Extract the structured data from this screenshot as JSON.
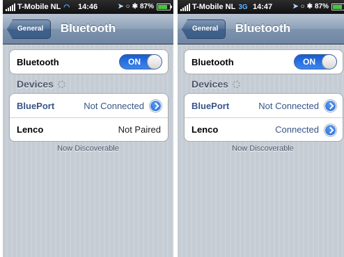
{
  "screens": [
    {
      "status": {
        "carrier": "T-Mobile NL",
        "network": "",
        "time": "14:46",
        "battery": "87%"
      },
      "nav": {
        "back": "General",
        "title": "Bluetooth"
      },
      "bluetooth": {
        "label": "Bluetooth",
        "toggle": "ON"
      },
      "devices_header": "Devices",
      "devices": [
        {
          "name": "BluePort",
          "status": "Not Connected"
        },
        {
          "name": "Lenco",
          "status": "Not Paired"
        }
      ],
      "footer": "Now Discoverable"
    },
    {
      "status": {
        "carrier": "T-Mobile NL",
        "network": "3G",
        "time": "14:47",
        "battery": "87%"
      },
      "nav": {
        "back": "General",
        "title": "Bluetooth"
      },
      "bluetooth": {
        "label": "Bluetooth",
        "toggle": "ON"
      },
      "devices_header": "Devices",
      "devices": [
        {
          "name": "BluePort",
          "status": "Not Connected"
        },
        {
          "name": "Lenco",
          "status": "Connected"
        }
      ],
      "footer": "Now Discoverable"
    }
  ],
  "colors": {
    "accent": "#3b86f0",
    "nav": "#7d93ad",
    "value_text": "#385487"
  }
}
